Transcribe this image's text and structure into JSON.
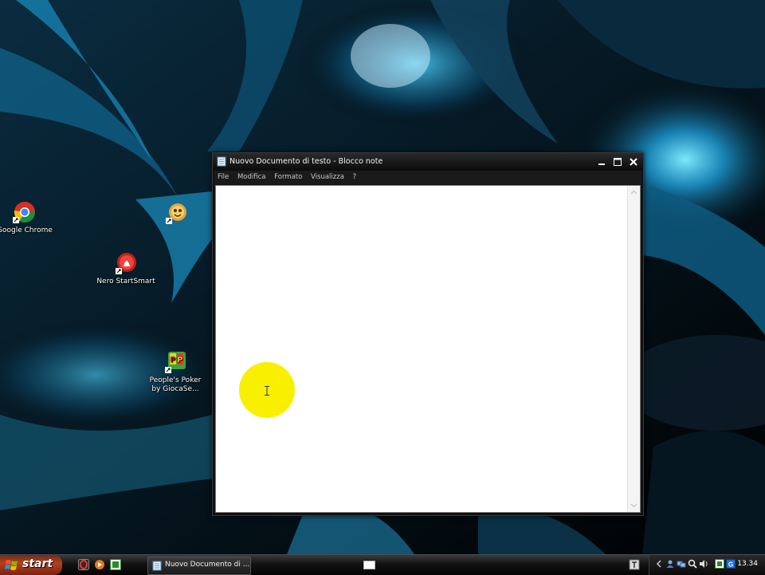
{
  "desktop": {
    "icons": [
      {
        "label": "Google Chrome",
        "icon": "chrome-icon"
      },
      {
        "label": "Nero StartSmart",
        "icon": "nero-icon"
      },
      {
        "label": "",
        "icon": "game-icon"
      },
      {
        "label": "People's Poker by GiocaSe...",
        "icon": "poker-icon"
      }
    ]
  },
  "window": {
    "title": "Nuovo Documento di testo - Blocco note",
    "menu": [
      "File",
      "Modifica",
      "Formato",
      "Visualizza",
      "?"
    ],
    "content": ""
  },
  "taskbar": {
    "start_label": "start",
    "task_label": "Nuovo Documento di ...",
    "clock": "13.34"
  },
  "colors": {
    "cursor_highlight": "#f8f000",
    "start_button": "#b5401f"
  }
}
